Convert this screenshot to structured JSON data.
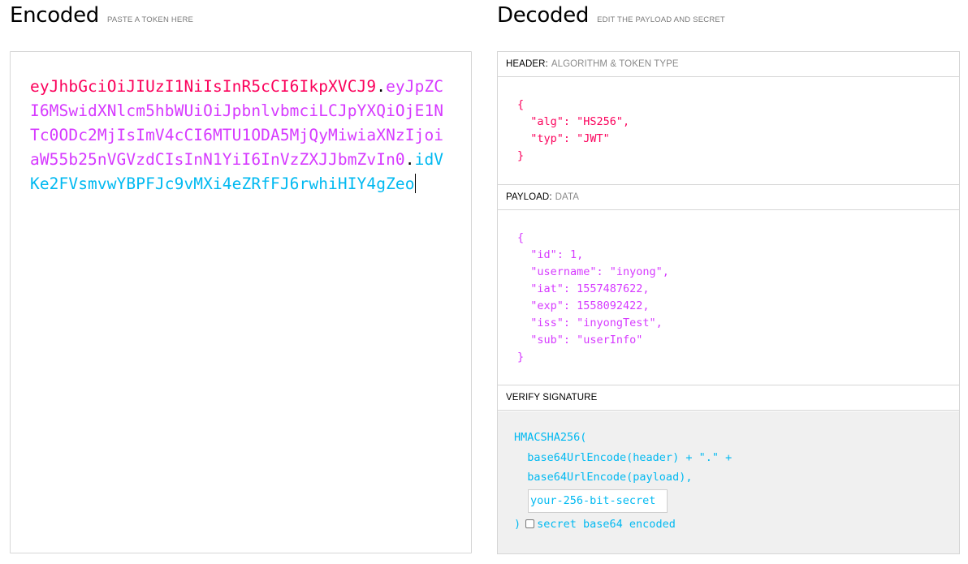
{
  "encoded": {
    "title": "Encoded",
    "subtitle": "PASTE A TOKEN HERE",
    "token_header": "eyJhbGciOiJIUzI1NiIsInR5cCI6IkpXVCJ9",
    "dot1": ".",
    "token_payload": "eyJpZCI6MSwidXNlcm5hbWUiOiJpbnlvbmciLCJpYXQiOjE1NTc0ODc2MjIsImV4cCI6MTU1ODA5MjQyMiwiaXNzIjoiaW55b25nVGVzdCIsInN1YiI6InVzZXJJbmZvIn0",
    "dot2": ".",
    "token_signature": "idVKe2FVsmvwYBPFJc9vMXi4eZRfFJ6rwhiHIY4gZeo"
  },
  "decoded": {
    "title": "Decoded",
    "subtitle": "EDIT THE PAYLOAD AND SECRET",
    "header": {
      "label": "HEADER:",
      "hint": "ALGORITHM & TOKEN TYPE",
      "json": "{\n  \"alg\": \"HS256\",\n  \"typ\": \"JWT\"\n}"
    },
    "payload": {
      "label": "PAYLOAD:",
      "hint": "DATA",
      "json": "{\n  \"id\": 1,\n  \"username\": \"inyong\",\n  \"iat\": 1557487622,\n  \"exp\": 1558092422,\n  \"iss\": \"inyongTest\",\n  \"sub\": \"userInfo\"\n}"
    },
    "signature": {
      "label": "VERIFY SIGNATURE",
      "line1": "HMACSHA256(",
      "line2": "  base64UrlEncode(header) + \".\" +",
      "line3": "  base64UrlEncode(payload),",
      "secret_value": "your-256-bit-secret",
      "close": ")",
      "checkbox_label": "secret base64 encoded",
      "checkbox_checked": false
    }
  },
  "colors": {
    "header": "#fb015b",
    "payload": "#d63aff",
    "signature": "#00b9f1"
  }
}
